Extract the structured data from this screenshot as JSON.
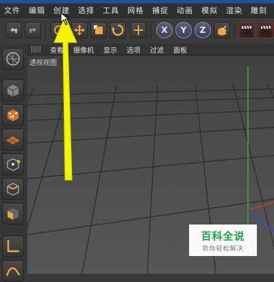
{
  "menubar": {
    "items": [
      "文件",
      "编辑",
      "创建",
      "选择",
      "工具",
      "网格",
      "捕捉",
      "动画",
      "模拟",
      "渲染",
      "雕刻"
    ]
  },
  "toolbar": {
    "axis_x_label": "X",
    "axis_y_label": "Y",
    "axis_z_label": "Z",
    "icons": [
      "undo-icon",
      "redo-icon",
      "live-select-icon",
      "move-icon",
      "scale-icon",
      "rotate-icon",
      "recent-tool-icon",
      "axis-x-toggle",
      "axis-y-toggle",
      "axis-z-toggle",
      "coordinate-system-icon",
      "render-view-icon",
      "render-to-picture-viewer-icon"
    ]
  },
  "viewport_menu": {
    "items": [
      "查看",
      "摄像机",
      "显示",
      "选项",
      "过滤",
      "面板"
    ]
  },
  "viewport": {
    "label": "透视视图"
  },
  "left_toolbar": {
    "icons": [
      "make-editable-icon",
      "model-mode-icon",
      "texture-mode-icon",
      "points-mode-icon",
      "edges-mode-icon",
      "polygons-mode-icon",
      "axis-mode-icon",
      "tweak-mode-icon"
    ]
  },
  "watermark": {
    "title": "百科全说",
    "subtitle": "助你轻松解决"
  },
  "colors": {
    "accent_orange": "#f2a33a",
    "annotation_arrow": "#f4f400",
    "watermark_green": "#19a34a",
    "axis_red": "#e03030",
    "axis_green": "#30b030",
    "axis_blue": "#3050e0"
  }
}
